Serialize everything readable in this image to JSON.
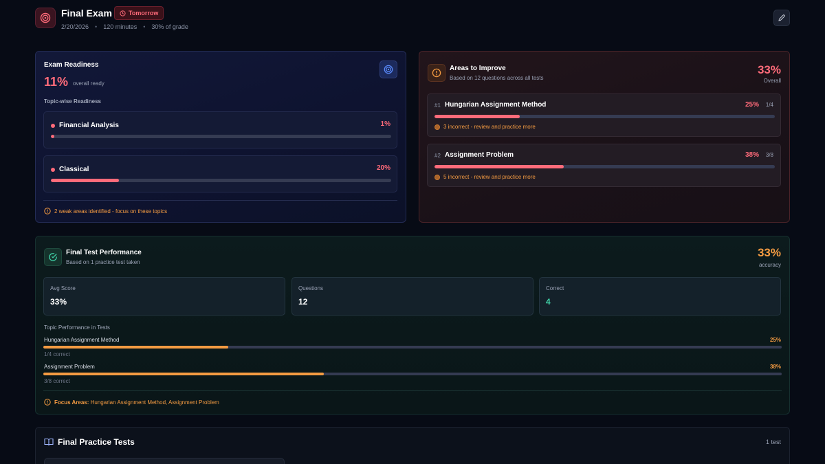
{
  "header": {
    "title": "Final Exam",
    "badge": "Tomorrow",
    "date": "2/20/2026",
    "duration": "120 minutes",
    "weight": "30% of grade"
  },
  "readiness": {
    "title": "Exam Readiness",
    "percent": "11%",
    "percent_label": "overall ready",
    "subtitle": "Topic-wise Readiness",
    "topics": [
      {
        "name": "Financial Analysis",
        "percent": "1%",
        "value": 1
      },
      {
        "name": "Classical",
        "percent": "20%",
        "value": 20
      }
    ],
    "warning": "2 weak areas identified - focus on these topics"
  },
  "improve": {
    "title": "Areas to Improve",
    "subtitle": "Based on 12 questions across all tests",
    "percent": "33%",
    "percent_label": "Overall",
    "items": [
      {
        "rank": "#1",
        "name": "Hungarian Assignment Method",
        "percent": "25%",
        "fraction": "1/4",
        "value": 25,
        "note": "3 incorrect - review and practice more"
      },
      {
        "rank": "#2",
        "name": "Assignment Problem",
        "percent": "38%",
        "fraction": "3/8",
        "value": 38,
        "note": "5 incorrect - review and practice more"
      }
    ]
  },
  "performance": {
    "title": "Final Test Performance",
    "subtitle": "Based on 1 practice test taken",
    "percent": "33%",
    "percent_label": "accuracy",
    "stats": [
      {
        "label": "Avg Score",
        "value": "33%"
      },
      {
        "label": "Questions",
        "value": "12"
      },
      {
        "label": "Correct",
        "value": "4"
      }
    ],
    "section_title": "Topic Performance in Tests",
    "topics": [
      {
        "name": "Hungarian Assignment Method",
        "percent": "25%",
        "value": 25,
        "sub": "1/4 correct"
      },
      {
        "name": "Assignment Problem",
        "percent": "38%",
        "value": 38,
        "sub": "3/8 correct"
      }
    ],
    "focus_label": "Focus Areas:",
    "focus_text": "Hungarian Assignment Method, Assignment Problem"
  },
  "practice": {
    "title": "Final Practice Tests",
    "count": "1 test"
  },
  "colors": {
    "accent_red": "#ff6b7a",
    "accent_orange": "#f49b42",
    "accent_green": "#3fd0a6",
    "accent_blue": "#5b8cff"
  },
  "icons": {
    "header": "target-icon",
    "edit": "pencil-icon",
    "readiness": "target-icon",
    "improve": "alert-circle-icon",
    "performance": "check-circle-icon",
    "practice": "book-open-icon",
    "badge": "clock-icon"
  }
}
